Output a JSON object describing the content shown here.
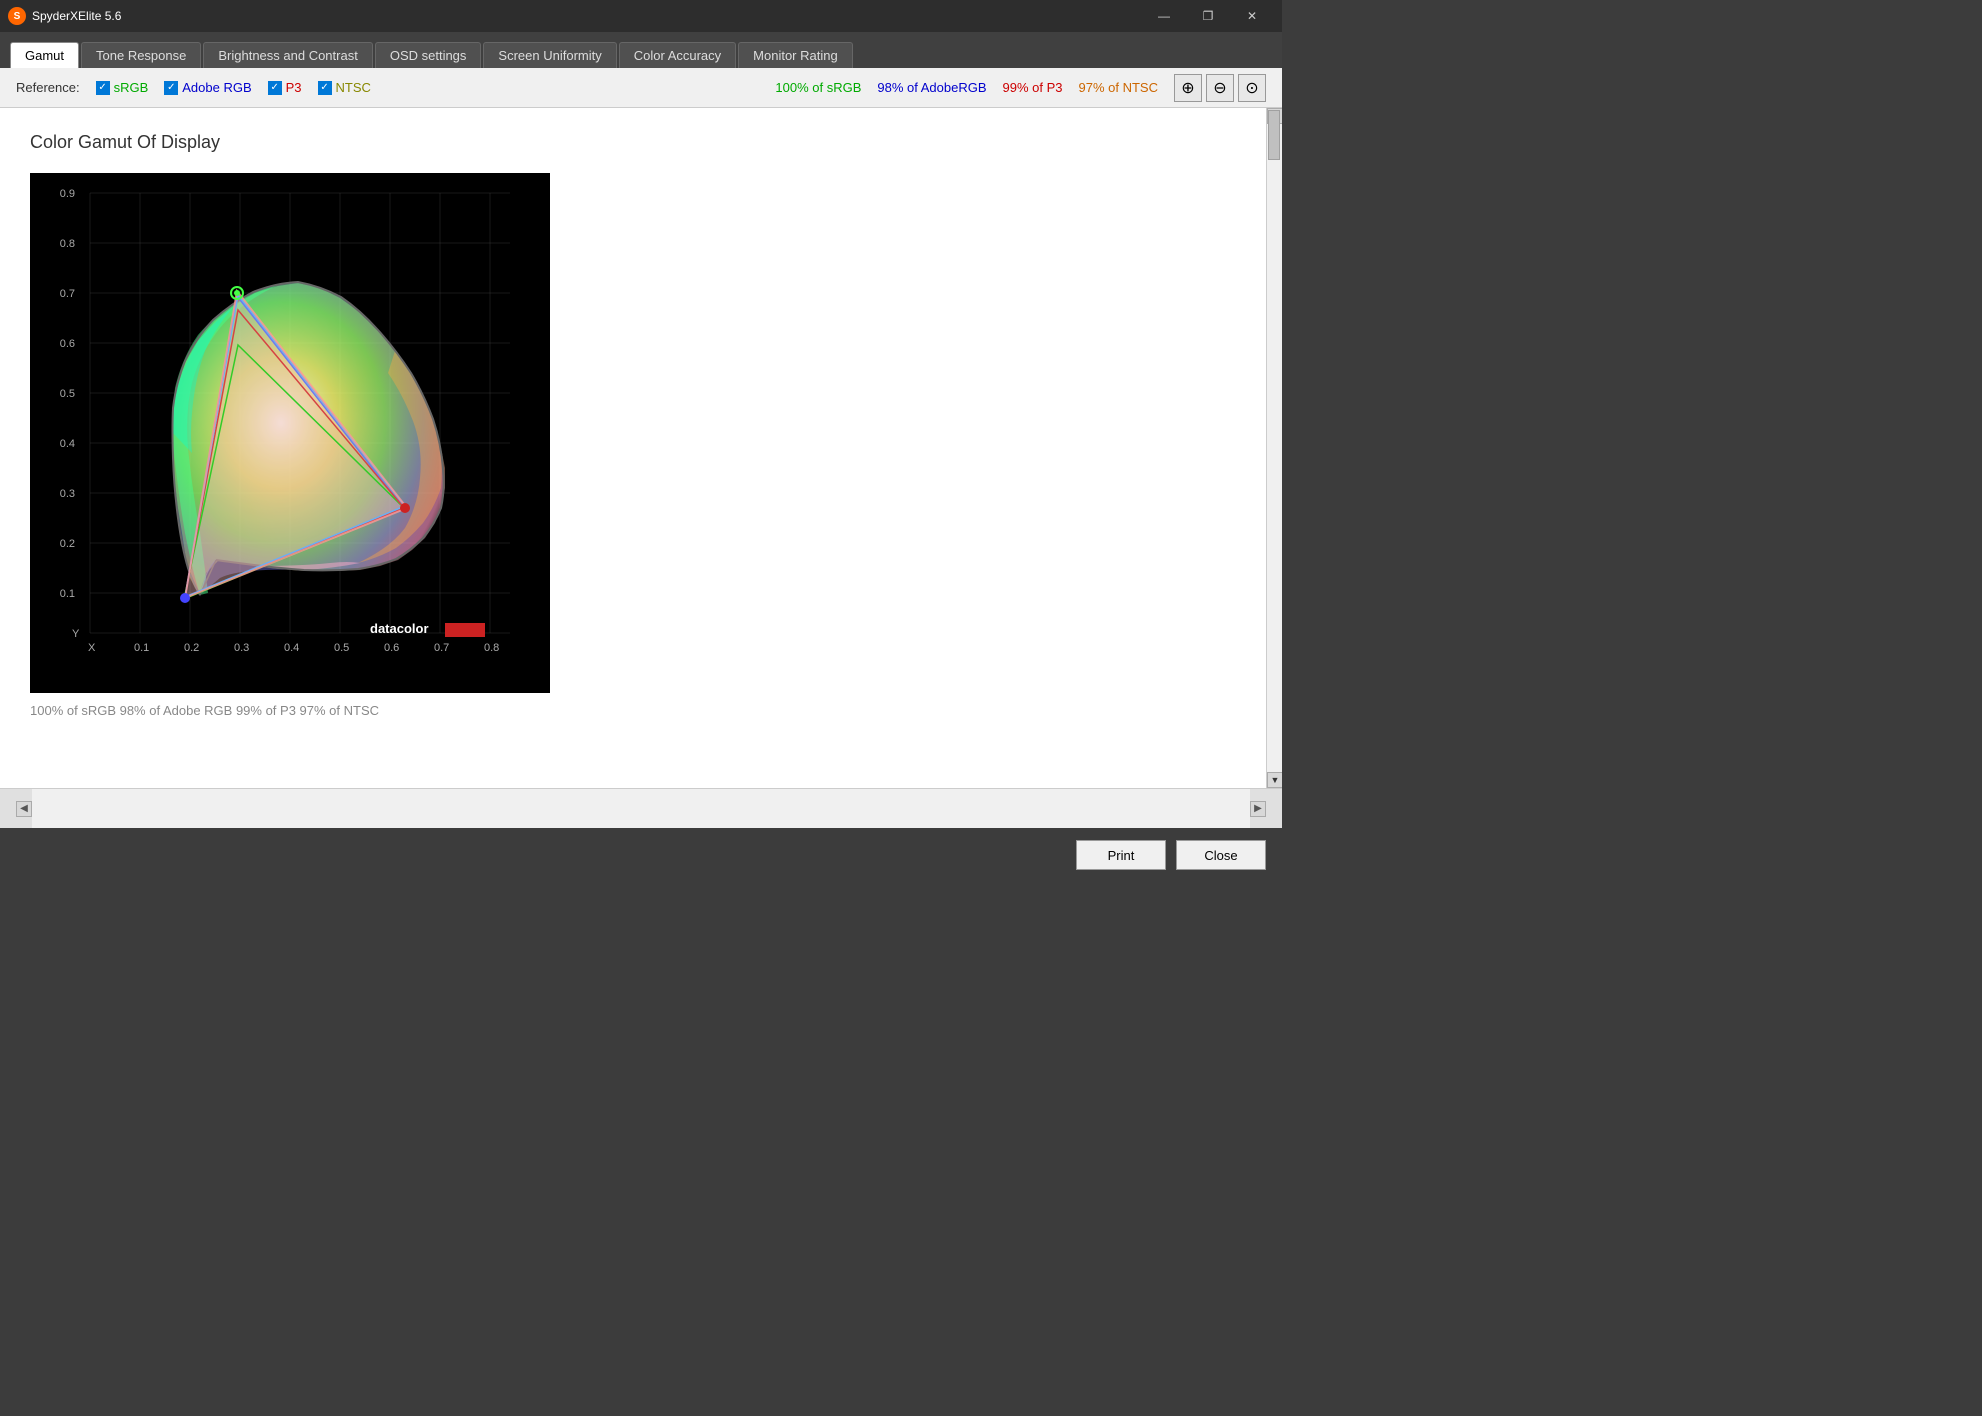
{
  "titlebar": {
    "app_icon": "S",
    "title": "SpyderXElite 5.6",
    "minimize": "—",
    "restore": "❐",
    "close": "✕"
  },
  "tabs": [
    {
      "label": "Gamut",
      "active": true
    },
    {
      "label": "Tone Response",
      "active": false
    },
    {
      "label": "Brightness and Contrast",
      "active": false
    },
    {
      "label": "OSD settings",
      "active": false
    },
    {
      "label": "Screen Uniformity",
      "active": false
    },
    {
      "label": "Color Accuracy",
      "active": false
    },
    {
      "label": "Monitor Rating",
      "active": false
    }
  ],
  "refbar": {
    "label": "Reference:",
    "items": [
      {
        "name": "sRGB",
        "checked": true,
        "color": "srgb"
      },
      {
        "name": "Adobe RGB",
        "checked": true,
        "color": "adobe"
      },
      {
        "name": "P3",
        "checked": true,
        "color": "p3"
      },
      {
        "name": "NTSC",
        "checked": true,
        "color": "ntsc"
      }
    ],
    "stats": [
      {
        "text": "100% of sRGB",
        "color": "stat-srgb"
      },
      {
        "text": "98% of AdobeRGB",
        "color": "stat-adobe"
      },
      {
        "text": "99% of P3",
        "color": "stat-p3"
      },
      {
        "text": "97% of NTSC",
        "color": "stat-ntsc"
      }
    ]
  },
  "main": {
    "title": "Color Gamut Of Display"
  },
  "bottombar": {
    "text": "100% of sRGB   98% of Adobe RGB   99% of P3   97% of NTSC"
  },
  "footer": {
    "print_label": "Print",
    "close_label": "Close"
  }
}
